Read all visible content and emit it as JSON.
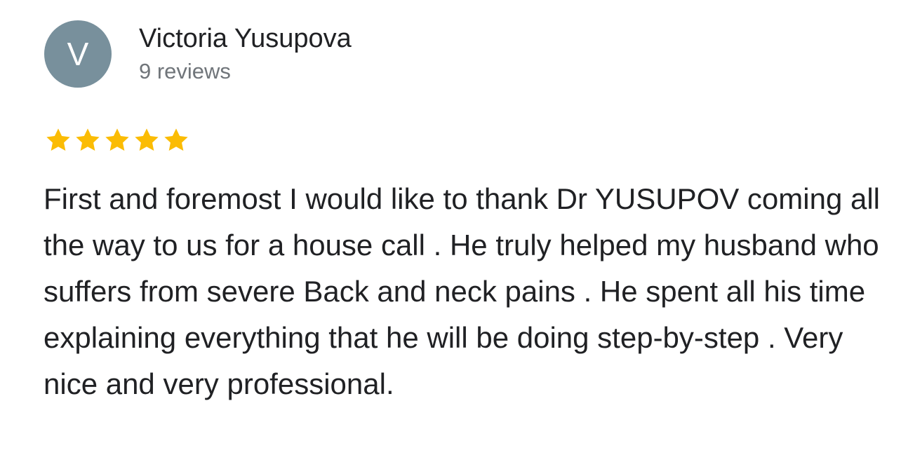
{
  "reviewer": {
    "initial": "V",
    "name": "Victoria Yusupova",
    "review_count": "9 reviews",
    "avatar_color": "#78909c"
  },
  "rating": {
    "stars": 5,
    "max": 5,
    "star_color": "#fbbc04"
  },
  "review": {
    "text": "First and foremost I would like to thank Dr YUSUPOV coming all the way to us for a house call . He truly helped my husband who suffers from severe Back and neck pains . He spent all his time explaining everything that he will be doing step-by-step . Very nice and very professional."
  }
}
